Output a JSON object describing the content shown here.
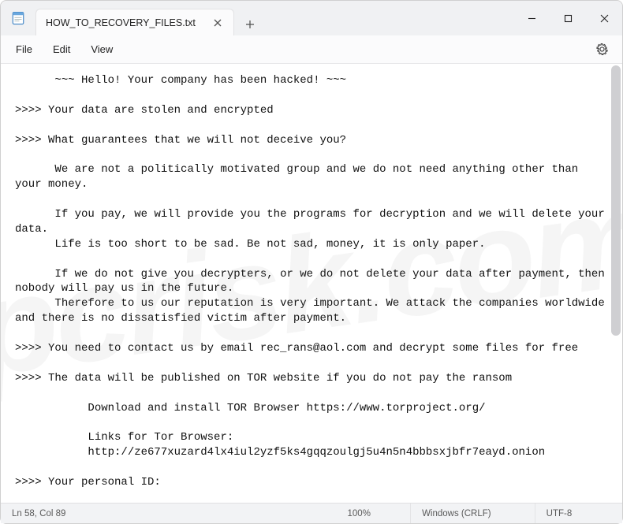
{
  "titlebar": {
    "tab_label": "HOW_TO_RECOVERY_FILES.txt"
  },
  "menubar": {
    "file": "File",
    "edit": "Edit",
    "view": "View"
  },
  "document": {
    "text": "      ~~~ Hello! Your company has been hacked! ~~~\n\n>>>> Your data are stolen and encrypted\n\n>>>> What guarantees that we will not deceive you?\n\n      We are not a politically motivated group and we do not need anything other than your money.\n\n      If you pay, we will provide you the programs for decryption and we will delete your data.\n      Life is too short to be sad. Be not sad, money, it is only paper.\n\n      If we do not give you decrypters, or we do not delete your data after payment, then nobody will pay us in the future.\n      Therefore to us our reputation is very important. We attack the companies worldwide and there is no dissatisfied victim after payment.\n\n>>>> You need to contact us by email rec_rans@aol.com and decrypt some files for free\n\n>>>> The data will be published on TOR website if you do not pay the ransom\n\n           Download and install TOR Browser https://www.torproject.org/\n\n           Links for Tor Browser:\n           http://ze677xuzard4lx4iul2yzf5ks4gqqzoulgj5u4n5n4bbbsxjbfr7eayd.onion\n\n>>>> Your personal ID:"
  },
  "watermark": {
    "text": "pcrisk.com"
  },
  "statusbar": {
    "position": "Ln 58, Col 89",
    "zoom": "100%",
    "line_endings": "Windows (CRLF)",
    "encoding": "UTF-8"
  }
}
